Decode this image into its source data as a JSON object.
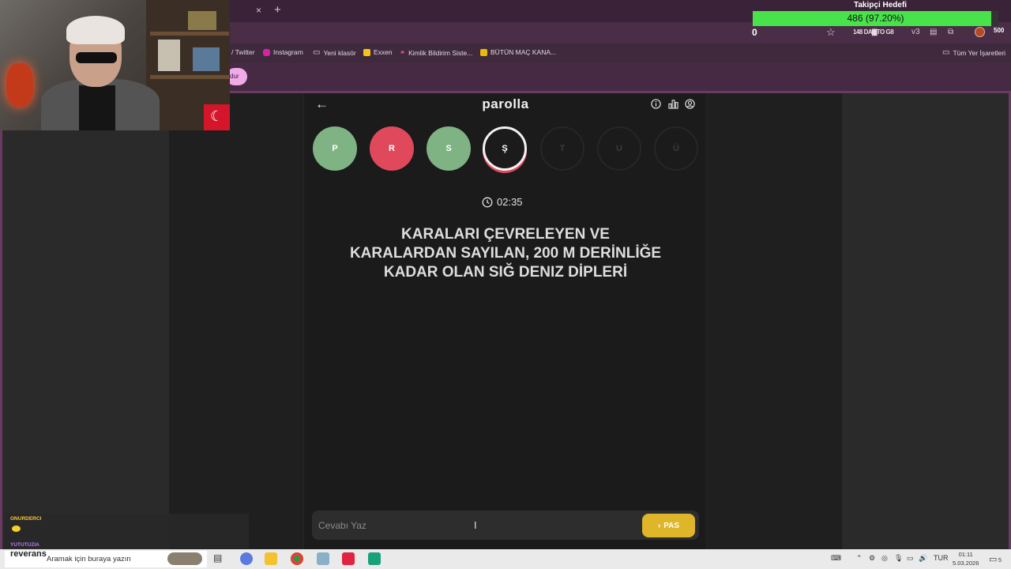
{
  "browser": {
    "tab_close": "×",
    "tab_new": "+",
    "extensions_text": "148 DA▇TO G8",
    "ext_v3": "v3",
    "bookmarks": [
      {
        "label": "/ Twitter",
        "color": ""
      },
      {
        "label": "Instagram",
        "color": "#d6249f"
      },
      {
        "label": "Yeni klasör",
        "color": ""
      },
      {
        "label": "Exxen",
        "color": "#f5c518"
      },
      {
        "label": "Kimlik Bildirim Siste...",
        "color": "#ff66aa"
      },
      {
        "label": "BÜTÜN MAÇ KANA...",
        "color": "#e8b80a"
      }
    ],
    "all_bookmarks": "Tüm Yer İşaretleri",
    "pill_label": "dur"
  },
  "follower_goal": {
    "title": "Takipçi Hedefi",
    "progress_text": "486 (97.20%)",
    "progress": 0.972,
    "start_value": "0",
    "target_value": "500",
    "bar_color": "#48e34a"
  },
  "game": {
    "logo": "parolla",
    "back_icon": "←",
    "letters": [
      {
        "letter": "P",
        "status": "correct"
      },
      {
        "letter": "R",
        "status": "wrong"
      },
      {
        "letter": "S",
        "status": "correct"
      },
      {
        "letter": "Ş",
        "status": "current"
      },
      {
        "letter": "T",
        "status": "pending"
      },
      {
        "letter": "U",
        "status": "pending"
      },
      {
        "letter": "Ü",
        "status": "pending"
      }
    ],
    "timer": "02:35",
    "clue": "KARALARI ÇEVRELEYEN VE KARALARDAN SAYILAN, 200 M DERİNLİĞE KADAR OLAN SIĞ DENIZ DİPLERİ",
    "answer_placeholder": "Cevabı Yaz",
    "pass_label": "PAS",
    "colors": {
      "correct": "#7fb384",
      "wrong": "#e0495c",
      "pass": "#dfb52a"
    }
  },
  "chat": {
    "user1": "ONURDERCI",
    "user2": "YUTUTUZIA"
  },
  "taskbar": {
    "reverans": "reverans",
    "search_placeholder": "Aramak için buraya yazın",
    "language": "TUR",
    "time": "01:11",
    "date": "5.03.2026",
    "notification_count": "5"
  }
}
